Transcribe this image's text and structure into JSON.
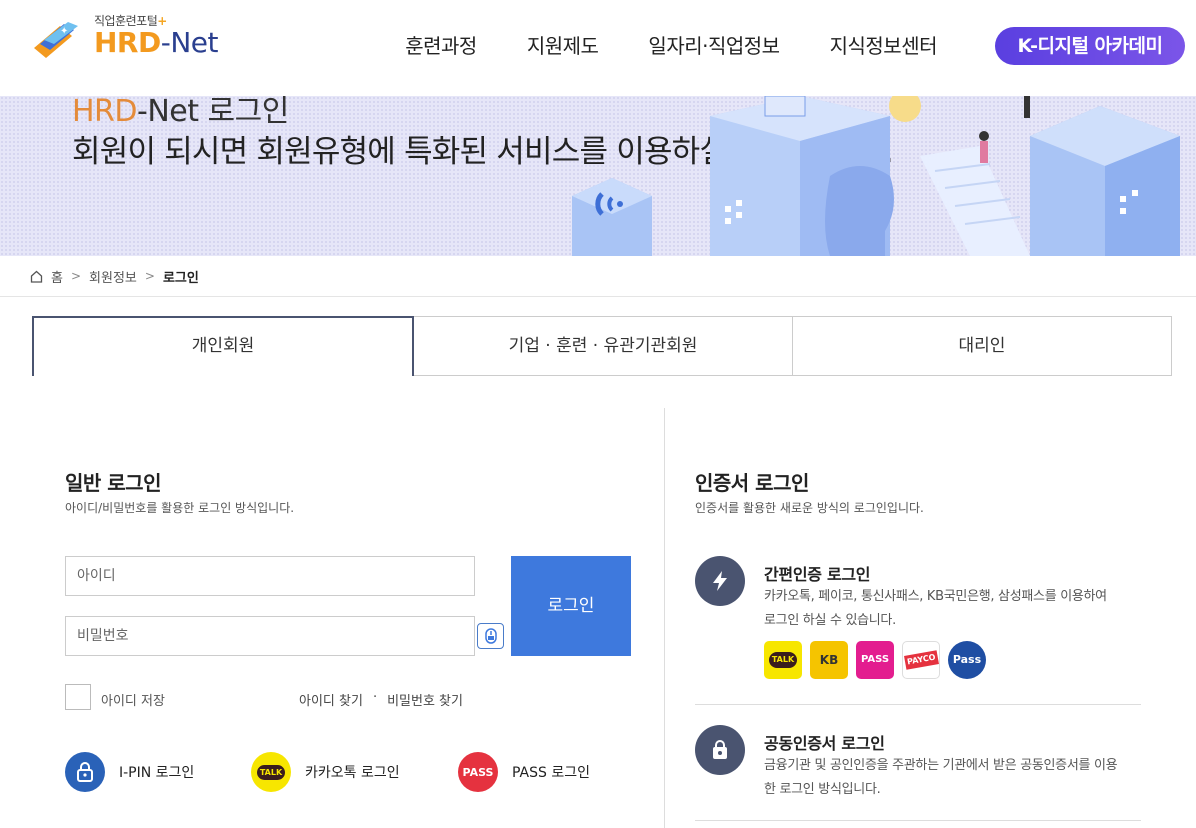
{
  "header": {
    "logo_sub": "직업훈련포털",
    "logo_plus": "+",
    "logo_hrd": "HRD",
    "logo_net": "-Net",
    "nav": [
      "훈련과정",
      "지원제도",
      "일자리·직업정보",
      "지식정보센터"
    ],
    "kdigital": "K-디지털 아카데미",
    "brand_colors": {
      "orange": "#f39a1f",
      "navy": "#2a3f8f",
      "purple": "#5a3fe0"
    }
  },
  "banner": {
    "title_hl": "HRD",
    "title_rest": "-Net 로그인",
    "desc": "회원이 되시면 회원유형에 특화된 서비스를 이용하실 수 있습니다."
  },
  "breadcrumb": {
    "home": "홈",
    "level1": "회원정보",
    "current": "로그인"
  },
  "tabs": [
    "개인회원",
    "기업 · 훈련 · 유관기관회원",
    "대리인"
  ],
  "general_login": {
    "title": "일반 로그인",
    "desc": "아이디/비밀번호를 활용한 로그인 방식입니다.",
    "id_placeholder": "아이디",
    "pw_placeholder": "비밀번호",
    "login_button": "로그인",
    "save_id": "아이디 저장",
    "find_id": "아이디 찾기",
    "dot": "·",
    "find_pw": "비밀번호 찾기",
    "ipin": "I-PIN 로그인",
    "kakao": "카카오톡 로그인",
    "kakao_icon_text": "TALK",
    "pass": "PASS 로그인",
    "pass_icon_text": "PASS"
  },
  "cert_login": {
    "title": "인증서 로그인",
    "desc": "인증서를 활용한 새로운 방식의 로그인입니다.",
    "simple_title": "간편인증 로그인",
    "simple_desc_1": "카카오톡, 페이코, 통신사패스, KB국민은행, 삼성패스를 이용하여",
    "simple_desc_2": "로그인 하실 수 있습니다.",
    "providers": [
      "TALK",
      "KB",
      "PASS",
      "PAYCO",
      "Pass"
    ],
    "joint_title": "공동인증서 로그인",
    "joint_desc_1": "금융기관 및 공인인증을 주관하는 기관에서 받은 공동인증서를 이용",
    "joint_desc_2": "한 로그인 방식입니다."
  }
}
